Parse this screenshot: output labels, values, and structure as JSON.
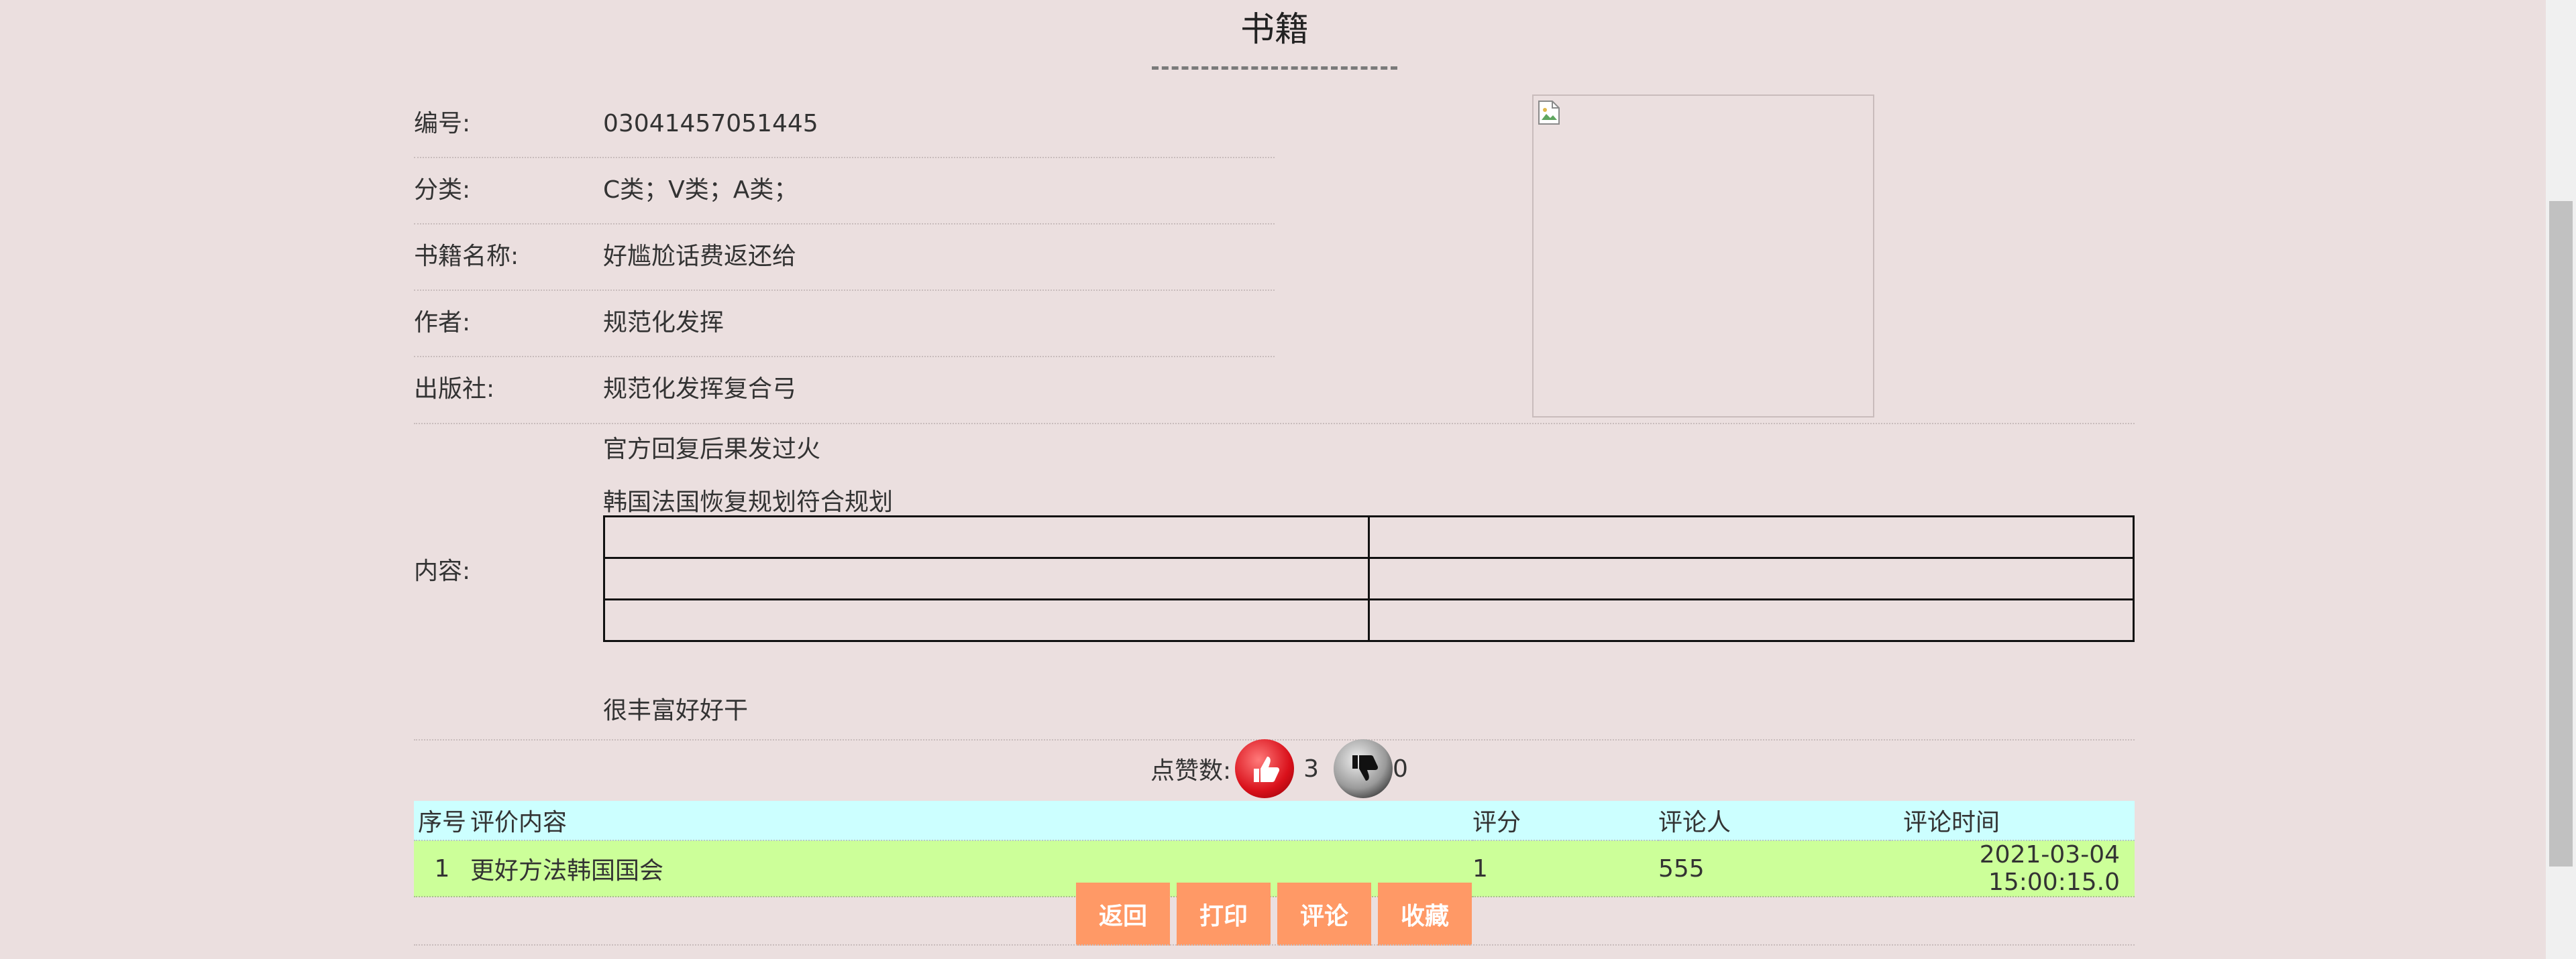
{
  "page": {
    "title": "书籍"
  },
  "book": {
    "fields": [
      {
        "label": "编号:",
        "value": "03041457051445"
      },
      {
        "label": "分类:",
        "value": "C类；V类；A类；"
      },
      {
        "label": "书籍名称:",
        "value": "好尴尬话费返还给"
      },
      {
        "label": "作者:",
        "value": "规范化发挥"
      },
      {
        "label": "出版社:",
        "value": "规范化发挥复合弓"
      }
    ],
    "content_label": "内容:",
    "content_lines": [
      "官方回复后果发过火",
      "韩国法国恢复规划符合规划",
      "很丰富好好干"
    ]
  },
  "likes": {
    "label": "点赞数:",
    "up_count": "3",
    "down_count": "0"
  },
  "reviews": {
    "headers": {
      "index": "序号",
      "content": "评价内容",
      "score": "评分",
      "reviewer": "评论人",
      "time": "评论时间"
    },
    "rows": [
      {
        "index": "1",
        "content": "更好方法韩国国会",
        "score": "1",
        "reviewer": "555",
        "time": "2021-03-04 15:00:15.0"
      }
    ]
  },
  "actions": {
    "back": "返回",
    "print": "打印",
    "comment": "评论",
    "favorite": "收藏"
  },
  "colors": {
    "background": "#ebdfdf",
    "header_row": "#ccffff",
    "data_row": "#ccff99",
    "button": "#ff9966",
    "like": "#d9101a"
  },
  "icons": {
    "photo": "broken-image-icon",
    "like": "thumbs-up-icon",
    "dislike": "thumbs-down-icon"
  }
}
